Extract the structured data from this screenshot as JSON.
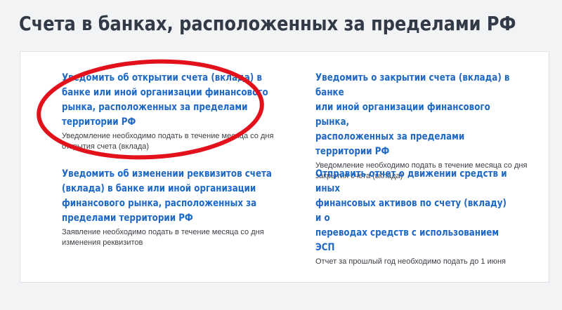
{
  "page": {
    "title": "Счета в банках, расположенных за пределами РФ"
  },
  "items": [
    {
      "link": "Уведомить об открытии счета (вклада) в\nбанке или иной организации финансового\nрынка, расположенных за пределами\nтерритории РФ",
      "description": "Уведомление необходимо подать в течение месяца со дня\nоткрытия счета (вклада)"
    },
    {
      "link": "Уведомить о закрытии счета (вклада) в банке\nили иной организации финансового рынка,\nрасположенных за пределами территории РФ",
      "description": "Уведомление необходимо подать в течение месяца со дня\nзакрытия счета (вклада)"
    },
    {
      "link": "Уведомить об изменении реквизитов счета\n(вклада) в банке или иной организации\nфинансового рынка, расположенных за\nпределами территории РФ",
      "description": "Заявление необходимо подать в течение месяца со дня\nизменения реквизитов"
    },
    {
      "link": "Отправить отчет о движении средств и иных\nфинансовых активов по счету (вкладу) и о\nпереводах средств с использованием ЭСП",
      "description": "Отчет за прошлый год необходимо подать до 1 июня"
    }
  ],
  "colors": {
    "link": "#1e68c6",
    "title": "#333a47",
    "annotation": "#e3111b",
    "background": "#f2f3f5"
  }
}
